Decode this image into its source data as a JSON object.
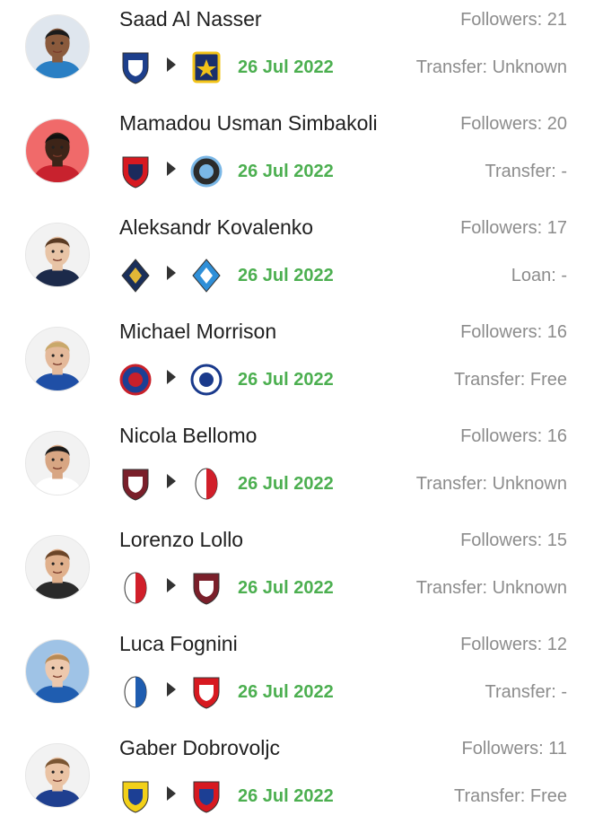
{
  "colors": {
    "date": "#4caf50",
    "secondary_text": "#8c8c8c",
    "name_text": "#202020"
  },
  "transfers": [
    {
      "name": "Saad Al Nasser",
      "followers": "Followers: 21",
      "date": "26 Jul 2022",
      "transfer": "Transfer: Unknown",
      "avatar": {
        "skin": "#8a5a3c",
        "hair": "#1b1b1b",
        "shirt": "#2a7fc4",
        "bg": "#dfe6ee"
      },
      "from": {
        "icon": "al-hilal-crest-icon",
        "shape": "shield",
        "c1": "#1d3f8c",
        "c2": "#ffffff"
      },
      "to": {
        "icon": "al-taawoun-crest-icon",
        "shape": "square",
        "c1": "#1a2f6b",
        "c2": "#f2c318"
      }
    },
    {
      "name": "Mamadou Usman Simbakoli",
      "followers": "Followers: 20",
      "date": "26 Jul 2022",
      "transfer": "Transfer: -",
      "avatar": {
        "skin": "#3d2418",
        "hair": "#111111",
        "shirt": "#c8222e",
        "bg": "#f06a6a"
      },
      "from": {
        "icon": "losc-lille-crest-icon",
        "shape": "shield",
        "c1": "#d71920",
        "c2": "#1b2a5c"
      },
      "to": {
        "icon": "star-club-crest-icon",
        "shape": "circle",
        "c1": "#7ab7e6",
        "c2": "#2b2b2b"
      }
    },
    {
      "name": "Aleksandr Kovalenko",
      "followers": "Followers: 17",
      "date": "26 Jul 2022",
      "transfer": "Loan: -",
      "avatar": {
        "skin": "#e8c4a6",
        "hair": "#5a3a22",
        "shirt": "#1c2a4a",
        "bg": "#f2f2f2"
      },
      "from": {
        "icon": "sochi-crest-icon",
        "shape": "diamond",
        "c1": "#1a2f5a",
        "c2": "#e2b736"
      },
      "to": {
        "icon": "krylia-sovetov-crest-icon",
        "shape": "diamond",
        "c1": "#2f8fd8",
        "c2": "#ffffff"
      }
    },
    {
      "name": "Michael Morrison",
      "followers": "Followers: 16",
      "date": "26 Jul 2022",
      "transfer": "Transfer: Free",
      "avatar": {
        "skin": "#e4b99a",
        "hair": "#c9a86a",
        "shirt": "#1f4fa6",
        "bg": "#f2f2f2"
      },
      "from": {
        "icon": "reading-crest-icon",
        "shape": "circle",
        "c1": "#c8202a",
        "c2": "#1c3f94"
      },
      "to": {
        "icon": "portsmouth-crest-icon",
        "shape": "circle",
        "c1": "#1a3a8c",
        "c2": "#ffffff"
      }
    },
    {
      "name": "Nicola Bellomo",
      "followers": "Followers: 16",
      "date": "26 Jul 2022",
      "transfer": "Transfer: Unknown",
      "avatar": {
        "skin": "#d8a683",
        "hair": "#1a1a1a",
        "shirt": "#ffffff",
        "bg": "#f2f2f2"
      },
      "from": {
        "icon": "reggina-crest-icon",
        "shape": "shield",
        "c1": "#7a1f2a",
        "c2": "#ffffff"
      },
      "to": {
        "icon": "bari-crest-icon",
        "shape": "oval",
        "c1": "#d11f2a",
        "c2": "#ffffff"
      }
    },
    {
      "name": "Lorenzo Lollo",
      "followers": "Followers: 15",
      "date": "26 Jul 2022",
      "transfer": "Transfer: Unknown",
      "avatar": {
        "skin": "#e0b08c",
        "hair": "#6b4528",
        "shirt": "#2a2a2a",
        "bg": "#f2f2f2"
      },
      "from": {
        "icon": "bari-crest-icon",
        "shape": "oval",
        "c1": "#d11f2a",
        "c2": "#ffffff"
      },
      "to": {
        "icon": "reggina-crest-icon",
        "shape": "shield",
        "c1": "#7a1f2a",
        "c2": "#ffffff"
      }
    },
    {
      "name": "Luca Fognini",
      "followers": "Followers: 12",
      "date": "26 Jul 2022",
      "transfer": "Transfer: -",
      "avatar": {
        "skin": "#edc8ad",
        "hair": "#b88a55",
        "shirt": "#1f5db0",
        "bg": "#9fc3e6"
      },
      "from": {
        "icon": "feralpisalo-crest-icon",
        "shape": "oval",
        "c1": "#1f5db0",
        "c2": "#ffffff"
      },
      "to": {
        "icon": "carpi-crest-icon",
        "shape": "shield",
        "c1": "#d71920",
        "c2": "#ffffff"
      }
    },
    {
      "name": "Gaber Dobrovoljc",
      "followers": "Followers: 11",
      "date": "26 Jul 2022",
      "transfer": "Transfer: Free",
      "avatar": {
        "skin": "#eac3a4",
        "hair": "#7a5532",
        "shirt": "#1f3f8f",
        "bg": "#f2f2f2"
      },
      "from": {
        "icon": "domzale-crest-icon",
        "shape": "shield",
        "c1": "#f2d018",
        "c2": "#1c3f94"
      },
      "to": {
        "icon": "kisvarda-crest-icon",
        "shape": "shield",
        "c1": "#d71920",
        "c2": "#1c3f94"
      }
    }
  ]
}
